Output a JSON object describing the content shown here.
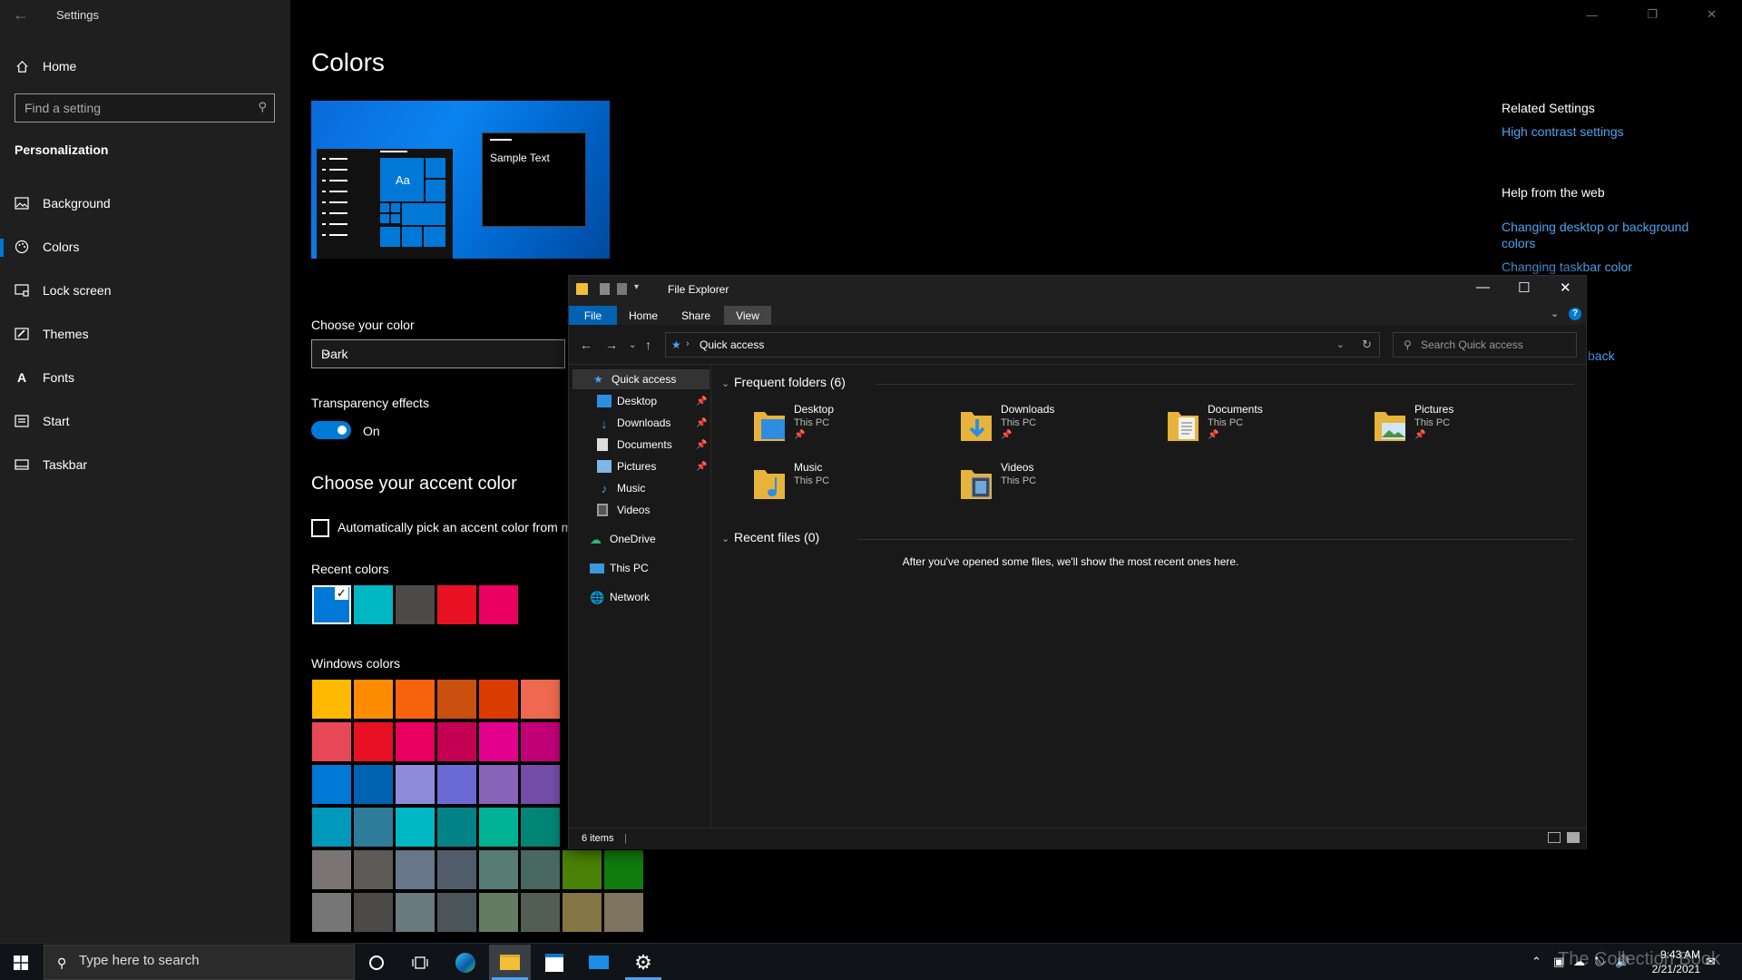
{
  "settings": {
    "app_title": "Settings",
    "home_label": "Home",
    "search_placeholder": "Find a setting",
    "section": "Personalization",
    "nav": [
      {
        "label": "Background",
        "icon": "image-icon"
      },
      {
        "label": "Colors",
        "icon": "palette-icon"
      },
      {
        "label": "Lock screen",
        "icon": "lock-screen-icon"
      },
      {
        "label": "Themes",
        "icon": "brush-icon"
      },
      {
        "label": "Fonts",
        "icon": "font-icon"
      },
      {
        "label": "Start",
        "icon": "start-icon"
      },
      {
        "label": "Taskbar",
        "icon": "taskbar-icon"
      }
    ],
    "active_nav": "Colors"
  },
  "colors_page": {
    "title": "Colors",
    "preview_sample_text": "Sample Text",
    "preview_tile_text": "Aa",
    "choose_color_label": "Choose your color",
    "choose_color_value": "Dark",
    "transparency_label": "Transparency effects",
    "transparency_state": "On",
    "accent_title": "Choose your accent color",
    "auto_pick_label": "Automatically pick an accent color from m",
    "recent_colors_label": "Recent colors",
    "recent_colors": [
      "#0078d7",
      "#00b7c3",
      "#4c4a48",
      "#e81123",
      "#ea005e"
    ],
    "windows_colors_label": "Windows colors",
    "windows_colors": [
      [
        "#ffb900",
        "#ff8c00",
        "#f7630c",
        "#ca5010",
        "#da3b01",
        "#ef6950"
      ],
      [
        "#e74856",
        "#e81123",
        "#ea005e",
        "#c30052",
        "#e3008c",
        "#bf0077"
      ],
      [
        "#0078d7",
        "#0063b1",
        "#8e8cd8",
        "#6b69d6",
        "#8764b8",
        "#744da9"
      ],
      [
        "#0099bc",
        "#2d7d9a",
        "#00b7c3",
        "#038387",
        "#00b294",
        "#018574"
      ],
      [
        "#7a7574",
        "#5d5a58",
        "#68768a",
        "#515c6b",
        "#567c73",
        "#486860",
        "#498205",
        "#107c10"
      ],
      [
        "#767676",
        "#4c4a48",
        "#69797e",
        "#4a5459",
        "#647c64",
        "#525e54",
        "#847545",
        "#7e735f"
      ]
    ]
  },
  "related": {
    "related_heading": "Related Settings",
    "high_contrast": "High contrast settings",
    "help_heading": "Help from the web",
    "link1": "Changing desktop or background colors",
    "link2": "Changing taskbar color",
    "link3_partial": "back"
  },
  "explorer": {
    "title": "File Explorer",
    "tabs": [
      "File",
      "Home",
      "Share",
      "View"
    ],
    "address": "Quick access",
    "search_placeholder": "Search Quick access",
    "tree": [
      {
        "label": "Quick access",
        "icon": "star-icon",
        "pinned": false
      },
      {
        "label": "Desktop",
        "icon": "desktop-folder-icon",
        "pinned": true
      },
      {
        "label": "Downloads",
        "icon": "downloads-folder-icon",
        "pinned": true
      },
      {
        "label": "Documents",
        "icon": "documents-folder-icon",
        "pinned": true
      },
      {
        "label": "Pictures",
        "icon": "pictures-folder-icon",
        "pinned": true
      },
      {
        "label": "Music",
        "icon": "music-folder-icon",
        "pinned": false
      },
      {
        "label": "Videos",
        "icon": "videos-folder-icon",
        "pinned": false
      },
      {
        "label": "OneDrive",
        "icon": "onedrive-icon",
        "pinned": false
      },
      {
        "label": "This PC",
        "icon": "this-pc-icon",
        "pinned": false
      },
      {
        "label": "Network",
        "icon": "network-icon",
        "pinned": false
      }
    ],
    "frequent_heading": "Frequent folders (6)",
    "folders": [
      {
        "name": "Desktop",
        "location": "This PC",
        "pinned": true,
        "icon": "desktop-folder-icon"
      },
      {
        "name": "Downloads",
        "location": "This PC",
        "pinned": true,
        "icon": "downloads-folder-icon"
      },
      {
        "name": "Documents",
        "location": "This PC",
        "pinned": true,
        "icon": "documents-folder-icon"
      },
      {
        "name": "Pictures",
        "location": "This PC",
        "pinned": true,
        "icon": "pictures-folder-icon"
      },
      {
        "name": "Music",
        "location": "This PC",
        "pinned": false,
        "icon": "music-folder-icon"
      },
      {
        "name": "Videos",
        "location": "This PC",
        "pinned": false,
        "icon": "videos-folder-icon"
      }
    ],
    "recent_heading": "Recent files (0)",
    "recent_empty": "After you've opened some files, we'll show the most recent ones here.",
    "status": "6 items"
  },
  "taskbar": {
    "search_placeholder": "Type here to search",
    "time": "9:43 AM",
    "date": "2/21/2021",
    "watermark": "The Collection Book"
  }
}
